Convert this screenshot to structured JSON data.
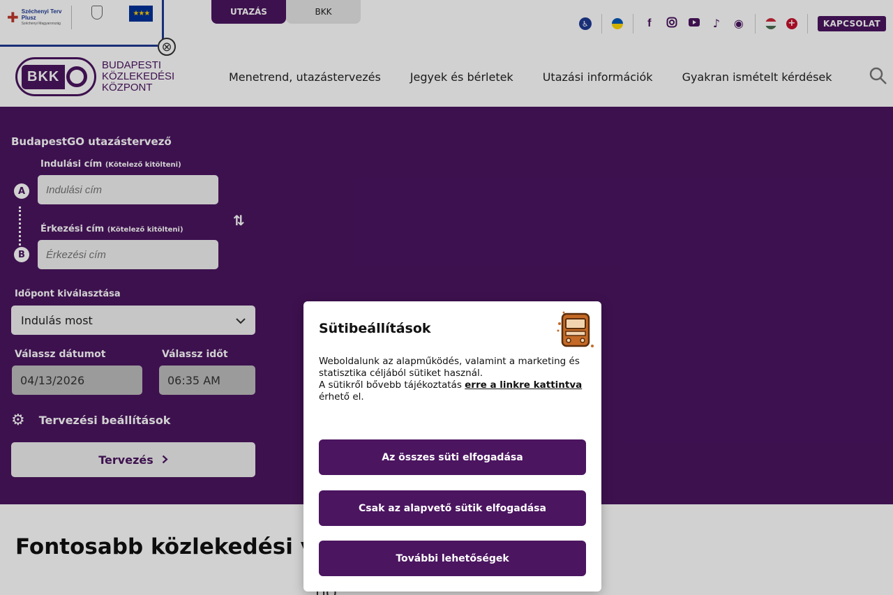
{
  "header": {
    "sponsor": {
      "szechenyi_title": "Széchenyi Terv",
      "szechenyi_sub": "Plusz",
      "szechenyi_small": "Széchenyi Magyarország"
    },
    "top_tabs": [
      "UTAZÁS",
      "BKK"
    ],
    "contact_label": "KAPCSOLAT",
    "logo_text": [
      "BUDAPESTI",
      "KÖZLEKEDÉSI",
      "KÖZPONT"
    ],
    "logo_abbr": "BKK",
    "nav": [
      "Menetrend, utazástervezés",
      "Jegyek és bérletek",
      "Utazási információk",
      "Gyakran ismételt kérdések"
    ]
  },
  "planner": {
    "title": "BudapestGO utazástervező",
    "from_label": "Indulási cím",
    "from_required": "(Kötelező kitölteni)",
    "from_placeholder": "Indulási cím",
    "to_label": "Érkezési cím",
    "to_required": "(Kötelező kitölteni)",
    "to_placeholder": "Érkezési cím",
    "pin_a": "A",
    "pin_b": "B",
    "time_label": "Időpont kiválasztása",
    "time_value": "Indulás most",
    "date_label": "Válassz dátumot",
    "date_value": "04/13/2026",
    "clock_label": "Válassz időt",
    "clock_value": "06:35 AM",
    "settings_label": "Tervezési beállítások",
    "plan_button": "Tervezés"
  },
  "section": {
    "title": "Fontosabb közlekedési v"
  },
  "cookie_modal": {
    "title": "Sütibeállítások",
    "text_1": "Weboldalunk az alapműködés, valamint a marketing és statisztika céljából sütiket használ.",
    "text_2": "A sütikről bővebb tájékoztatás",
    "link": "erre a linkre kattintva",
    "text_3": "érhető el.",
    "accept_all": "Az összes süti elfogadása",
    "accept_essential": "Csak az alapvető sütik elfogadása",
    "more_options": "További lehetőségek"
  },
  "colors": {
    "brand_purple": "#4b1560",
    "hero_bg": "#4b1560"
  },
  "icons": [
    "accessibility-icon",
    "ukrainian-flag-icon",
    "facebook-icon",
    "instagram-icon",
    "youtube-icon",
    "tiktok-icon",
    "podcast-icon",
    "hungarian-flag-icon",
    "english-flag-icon",
    "search-icon",
    "swap-icon",
    "gear-icon",
    "chevron-down-icon",
    "chevron-right-icon"
  ]
}
